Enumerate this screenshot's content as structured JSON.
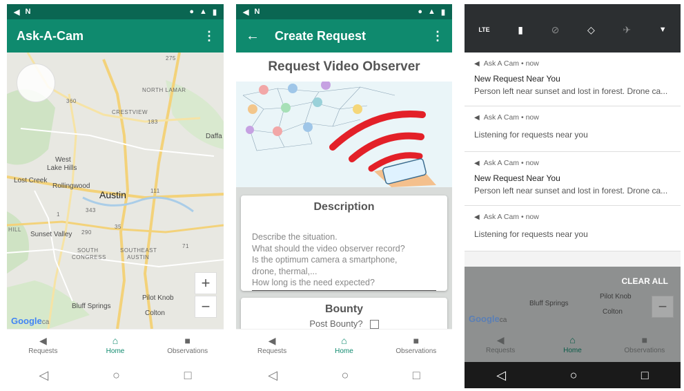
{
  "screen1": {
    "status_icons": [
      "megaphone-icon",
      "n-icon",
      "location-icon",
      "lte-icon",
      "battery-icon"
    ],
    "app_title": "Ask-A-Cam",
    "map": {
      "labels": [
        "NORTH LAMAR",
        "CRESTVIEW",
        "West",
        "Lake Hills",
        "Lost Creek",
        "Rollingwood",
        "Austin",
        "Sunset Valley",
        "HILL",
        "SOUTH",
        "CONGRESS",
        "SOUTHEAST",
        "AUSTIN",
        "Bluff Springs",
        "Pilot Knob",
        "Colton",
        "Daffa"
      ],
      "shields": [
        "275",
        "360",
        "183",
        "111",
        "1",
        "343",
        "290",
        "35",
        "71"
      ],
      "google": "Google",
      "google_suffix": "ca",
      "zoom_in": "+",
      "zoom_out": "−"
    },
    "nav": [
      {
        "label": "Requests",
        "icon": "megaphone-icon",
        "active": false
      },
      {
        "label": "Home",
        "icon": "home-icon",
        "active": true
      },
      {
        "label": "Observations",
        "icon": "camera-icon",
        "active": false
      }
    ]
  },
  "screen2": {
    "app_title": "Create Request",
    "heading": "Request Video Observer",
    "description": {
      "title": "Description",
      "placeholder_lines": [
        "Describe the situation.",
        "What should the video observer record?",
        "Is the optimum camera a smartphone,",
        "drone, thermal,...",
        "How long is the need expected?"
      ]
    },
    "bounty": {
      "title": "Bounty",
      "post_label": "Post Bounty?"
    },
    "nav": [
      {
        "label": "Requests"
      },
      {
        "label": "Home"
      },
      {
        "label": "Observations"
      }
    ]
  },
  "screen3": {
    "quick_settings": [
      "lte-icon",
      "battery-icon",
      "dnd-icon",
      "rotate-icon",
      "airplane-icon",
      "chevron-down-icon"
    ],
    "quick_settings_lte": "LTE",
    "notifications": [
      {
        "source": "Ask A Cam • now",
        "title": "New Request Near You",
        "body": "Person left near sunset and lost in forest. Drone ca..."
      },
      {
        "source": "Ask A Cam • now",
        "title": "",
        "body": "Listening for requests near you"
      },
      {
        "source": "Ask A Cam • now",
        "title": "New Request Near You",
        "body": "Person left near sunset and lost in forest. Drone ca..."
      },
      {
        "source": "Ask A Cam • now",
        "title": "",
        "body": "Listening for requests near you"
      }
    ],
    "clear_all": "CLEAR ALL",
    "map_labels": [
      "Bluff Springs",
      "Pilot Knob",
      "Colton"
    ],
    "google": "Google",
    "google_suffix": "ca",
    "zoom_out": "−",
    "nav": [
      {
        "label": "Requests"
      },
      {
        "label": "Home"
      },
      {
        "label": "Observations"
      }
    ]
  },
  "colors": {
    "status_bar": "#0a6652",
    "app_bar": "#0f8a6e",
    "accent": "#0f8a6e",
    "shade": "#2c2f31"
  }
}
